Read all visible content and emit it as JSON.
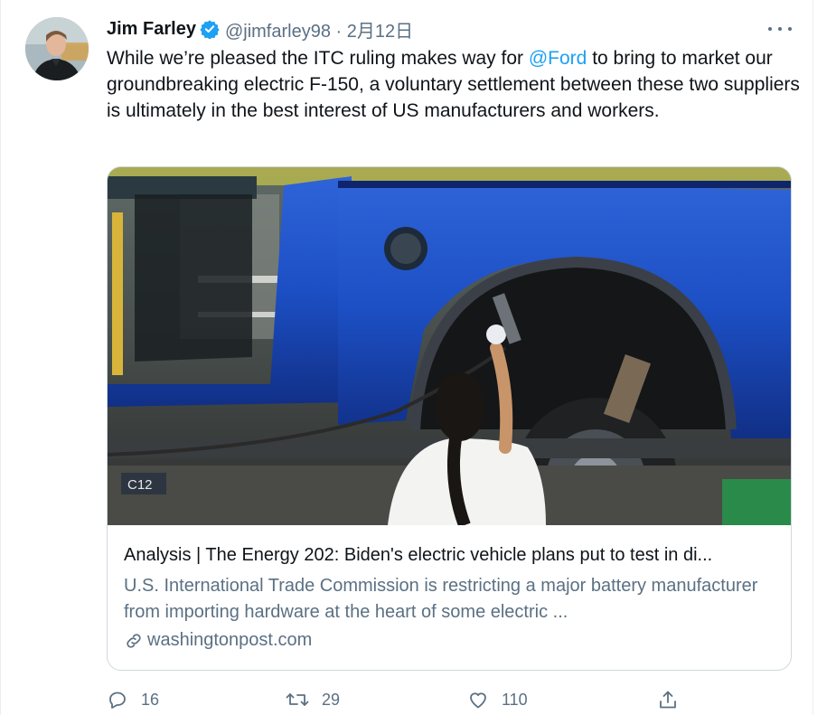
{
  "tweet": {
    "author_name": "Jim Farley",
    "handle_and_date": "@jimfarley98 · 2月12日",
    "text_before_mention": "While we’re pleased the ITC ruling makes way for ",
    "mention": "@Ford",
    "text_after_mention": " to bring to market our groundbreaking electric F-150, a voluntary settlement between these two suppliers is ultimately in the best interest of US manufacturers and workers."
  },
  "card": {
    "title": "Analysis | The Energy 202: Biden's electric vehicle plans put to test in di...",
    "description": "U.S. International Trade Commission is restricting a major battery manufacturer from importing hardware at the heart of some electric ...",
    "domain": "washingtonpost.com",
    "image_label": "C12"
  },
  "actions": {
    "replies": "16",
    "retweets": "29",
    "likes": "110"
  },
  "icons": {
    "verified": "verified-badge-icon",
    "more": "more-dots-icon",
    "reply": "reply-icon",
    "retweet": "retweet-icon",
    "like": "heart-icon",
    "share": "share-icon",
    "link": "link-icon"
  },
  "colors": {
    "accent": "#1da1f2",
    "text": "#0f1419",
    "secondary": "#5b7083",
    "border": "#cfd9de",
    "truck_blue": "#1c4fc4"
  }
}
